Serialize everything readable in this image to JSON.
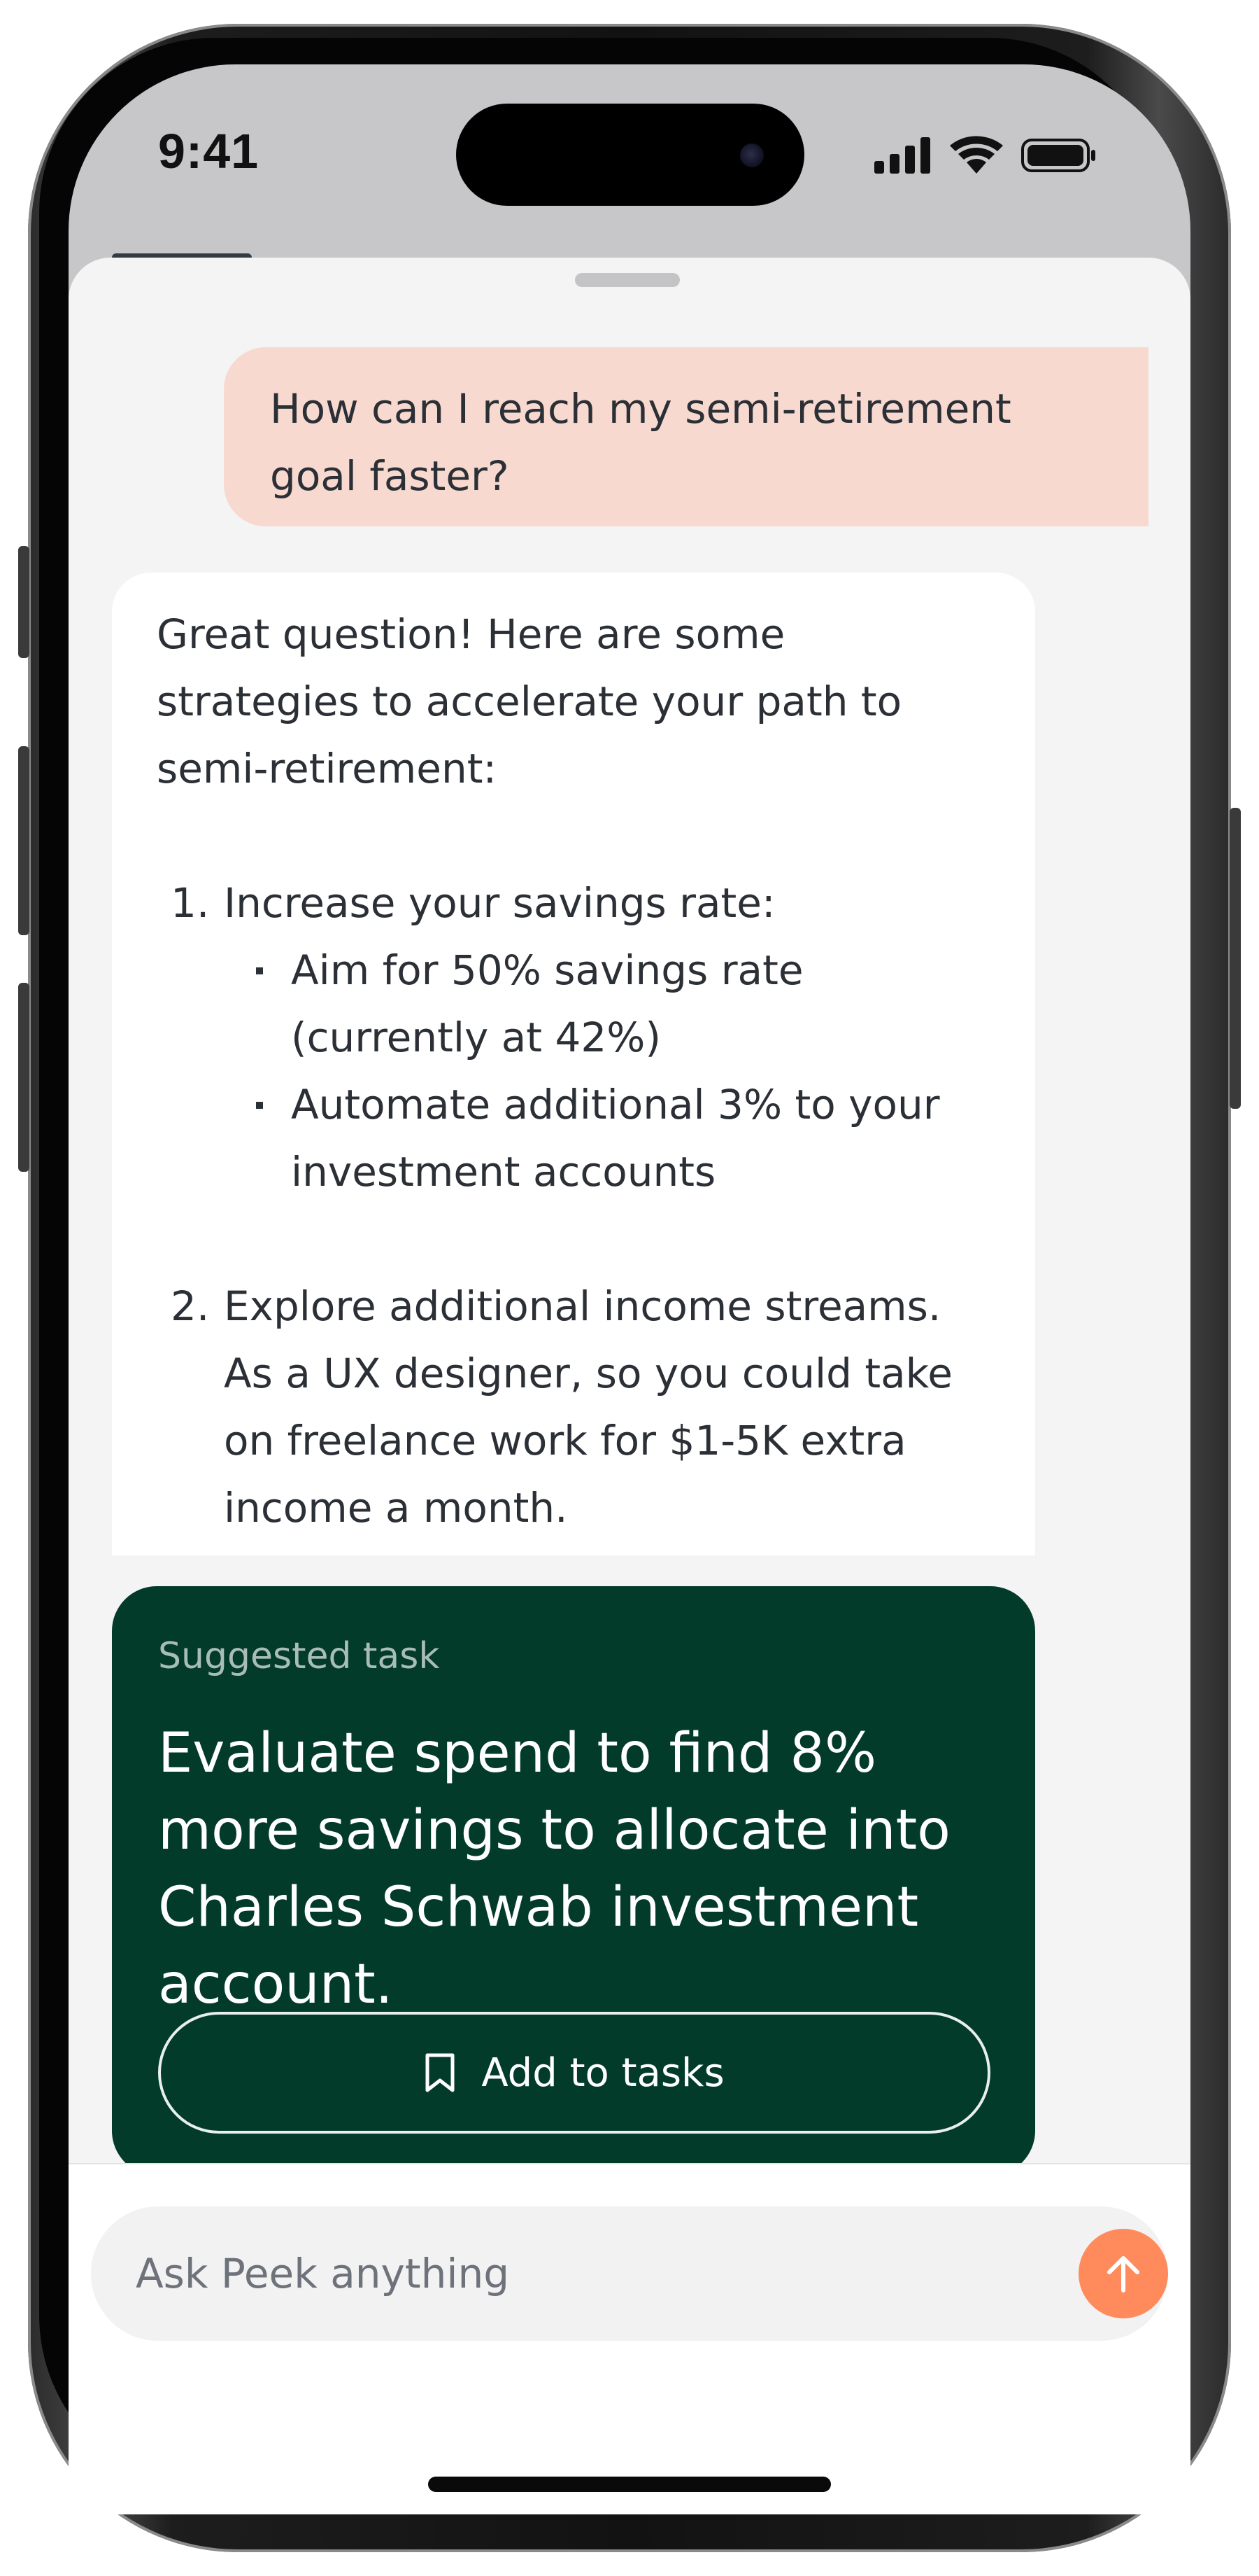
{
  "status_bar": {
    "time": "9:41"
  },
  "chat": {
    "user_message": "How can I reach my semi-retirement goal faster?",
    "assistant": {
      "intro": "Great question! Here are some strategies to accelerate your path to semi-retirement:",
      "items": [
        {
          "number": "1.",
          "text": "Increase your savings rate:",
          "bullets": [
            "Aim for 50% savings rate (currently at 42%)",
            "Automate additional 3% to your investment accounts"
          ]
        },
        {
          "number": "2.",
          "text": "Explore additional income streams. As a UX designer, so you could take on freelance work for $1-5K extra income a month."
        }
      ]
    }
  },
  "suggested_task": {
    "label": "Suggested task",
    "title": "Evaluate spend to find 8% more savings to allocate into Charles Schwab investment account.",
    "button_label": "Add to tasks",
    "button_icon": "bookmark-icon"
  },
  "composer": {
    "placeholder": "Ask Peek anything",
    "send_icon": "arrow-up-icon"
  },
  "colors": {
    "user_bubble": "#f8d9cf",
    "task_card": "#023b2a",
    "send_button": "#ff8b5c",
    "sheet_background": "#f4f4f5"
  }
}
